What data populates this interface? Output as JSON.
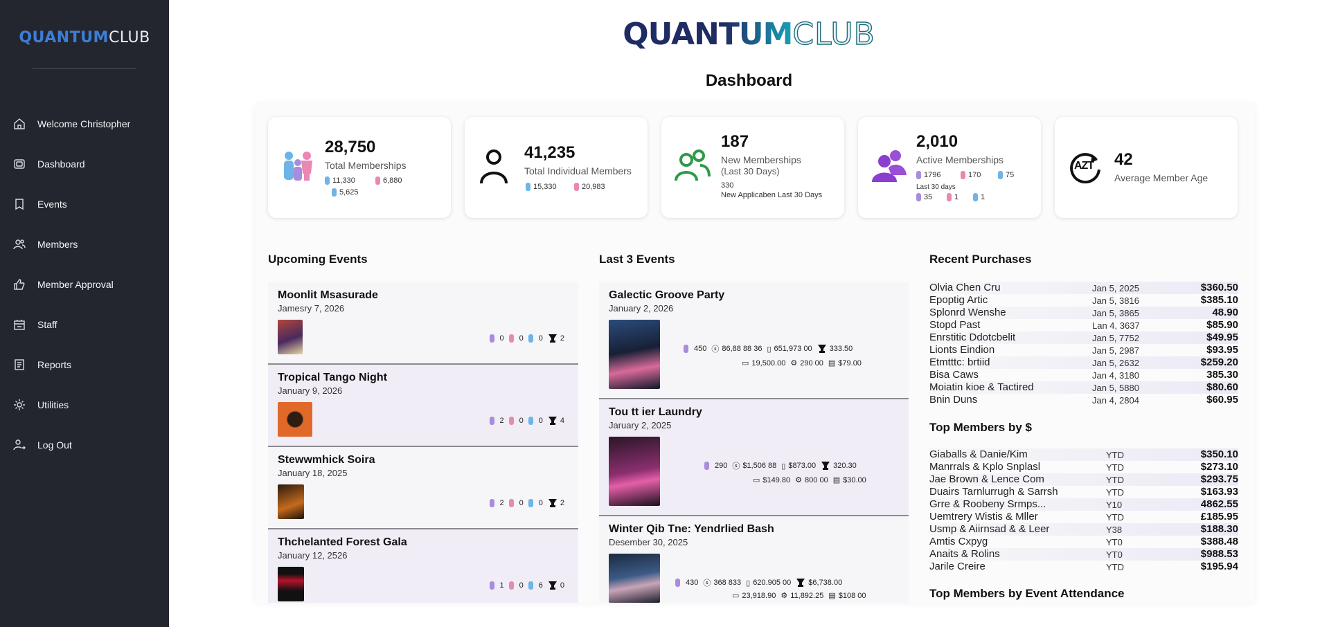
{
  "app": {
    "logo_part1": "QUANTUM",
    "logo_part2": "CLUB"
  },
  "sidebar": {
    "items": [
      {
        "label": "Welcome Christopher",
        "icon": "home-icon"
      },
      {
        "label": "Dashboard",
        "icon": "dashboard-icon"
      },
      {
        "label": "Events",
        "icon": "events-icon"
      },
      {
        "label": "Members",
        "icon": "members-icon"
      },
      {
        "label": "Member Approval",
        "icon": "thumbs-up-icon"
      },
      {
        "label": "Staff",
        "icon": "staff-icon"
      },
      {
        "label": "Reports",
        "icon": "reports-icon"
      },
      {
        "label": "Utilities",
        "icon": "gear-icon"
      },
      {
        "label": "Log Out",
        "icon": "logout-icon"
      }
    ]
  },
  "page": {
    "title": "Dashboard"
  },
  "stats": [
    {
      "value": "28,750",
      "label": "Total Memberships",
      "l1a": "11,330",
      "l1b": "6,880",
      "l2": "5,625"
    },
    {
      "value": "41,235",
      "label": "Total Individual Members",
      "a": "15,330",
      "b": "20,983"
    },
    {
      "value": "187",
      "label": "New Memberships",
      "label2": "(Last 30 Days)",
      "sub_value": "330",
      "sub_label": "New Applicaben Last 30 Days"
    },
    {
      "value": "2,010",
      "label": "Active Memberships",
      "a": "1796",
      "b": "170",
      "c": "75",
      "sub_label": "Last 30 days",
      "d": "35",
      "e": "1",
      "f": "1"
    },
    {
      "value": "42",
      "label": "Average Member Age",
      "icon_text": "AZT"
    }
  ],
  "upcoming": {
    "title": "Upcoming Events",
    "events": [
      {
        "name": "Moonlit Msasurade",
        "date": "Jamesry 7, 2026",
        "c1": "0",
        "c2": "0",
        "c3": "0",
        "c4": "2"
      },
      {
        "name": "Tropical Tango Night",
        "date": "January 9, 2026",
        "c1": "2",
        "c2": "0",
        "c3": "0",
        "c4": "4"
      },
      {
        "name": "Stewwmhick Soira",
        "date": "January 18, 2025",
        "c1": "2",
        "c2": "0",
        "c3": "0",
        "c4": "2"
      },
      {
        "name": "Thchelanted Forest Gala",
        "date": "January 12, 2526",
        "c1": "1",
        "c2": "0",
        "c3": "6",
        "c4": "0"
      }
    ]
  },
  "last_events": {
    "title": "Last 3 Events",
    "events": [
      {
        "name": "Galectic Groove Party",
        "date": "January 2, 2026",
        "attend": "450",
        "rev": "86,88 88 36",
        "cost": "651,973 00",
        "prize": "333.50",
        "bar": "19,500.00",
        "food": "290 00",
        "other": "$79.00"
      },
      {
        "name": "Tou tt ier Laundry",
        "date": "Jaruary 2, 2025",
        "attend": "290",
        "rev": "$1,506 88",
        "cost": "$873.00",
        "prize": "320.30",
        "bar": "$149.80",
        "food": "800 00",
        "other": "$30.00"
      },
      {
        "name": "Winter Qib Tne: Yendrlied Bash",
        "date": "Desember 30, 2025",
        "attend": "430",
        "rev": "368 833",
        "cost": "620.905 00",
        "prize": "$6,738.00",
        "bar": "23,918.90",
        "food": "11,892.25",
        "other": "$108 00"
      }
    ]
  },
  "recent_purchases": {
    "title": "Recent Purchases",
    "rows": [
      {
        "name": "Olvia Chen Cru",
        "date": "Jan 5, 2025",
        "amount": "$360.50"
      },
      {
        "name": "Epoptig Artic",
        "date": "Jan 5, 3816",
        "amount": "$385.10"
      },
      {
        "name": "Splonrd Wenshe",
        "date": "Jan 5, 3865",
        "amount": "48.90"
      },
      {
        "name": "Stopd Past",
        "date": "Lan 4, 3637",
        "amount": "$85.90"
      },
      {
        "name": "Enrstitic Ddotcbelit",
        "date": "Jan 5, 7752",
        "amount": "$49.95"
      },
      {
        "name": "Lionts Eindion",
        "date": "Jan 5, 2987",
        "amount": "$93.95"
      },
      {
        "name": "Etmtttc: brtiid",
        "date": "Jan 5, 2632",
        "amount": "$259.20"
      },
      {
        "name": "Bisa Caws",
        "date": "Jan 4, 3180",
        "amount": "385.30"
      },
      {
        "name": "Moiatin kioe & Tactired",
        "date": "Jan 5, 5880",
        "amount": "$80.60"
      },
      {
        "name": "Bnin Duns",
        "date": "Jan 4, 2804",
        "amount": "$60.95"
      }
    ]
  },
  "top_members": {
    "title": "Top Members by $",
    "rows": [
      {
        "name": "Giaballs & Danie/Kim",
        "date": "YTD",
        "amount": "$350.10"
      },
      {
        "name": "Manrrals & Kplo Snplasl",
        "date": "YTD",
        "amount": "$273.10"
      },
      {
        "name": "Jae Brown & Lence Com",
        "date": "YTD",
        "amount": "$293.75"
      },
      {
        "name": "Duairs Tarnlurrugh & Sarrsh",
        "date": "YTD",
        "amount": "$163.93"
      },
      {
        "name": "Grre & Roobeny Srmps...",
        "date": "Y10",
        "amount": "4862.55"
      },
      {
        "name": "Uemtrery Wistis & Mller",
        "date": "YTD",
        "amount": "£185.95"
      },
      {
        "name": "Usmp & Aiirnsad & & Leer",
        "date": "Y38",
        "amount": "$188.30"
      },
      {
        "name": "Amtis Cxpyg",
        "date": "YT0",
        "amount": "$388.48"
      },
      {
        "name": "Anaits & Rolins",
        "date": "YT0",
        "amount": "$988.53"
      },
      {
        "name": "Jarile Creire",
        "date": "YTD",
        "amount": "$195.94"
      }
    ]
  },
  "top_attendance": {
    "title": "Top Members by Event Attendance"
  },
  "colors": {
    "sidebar_bg": "#23262e",
    "accent_blue": "#3d7ed6",
    "brand_navy": "#1f2c63",
    "brand_teal": "#1aa0b8"
  }
}
